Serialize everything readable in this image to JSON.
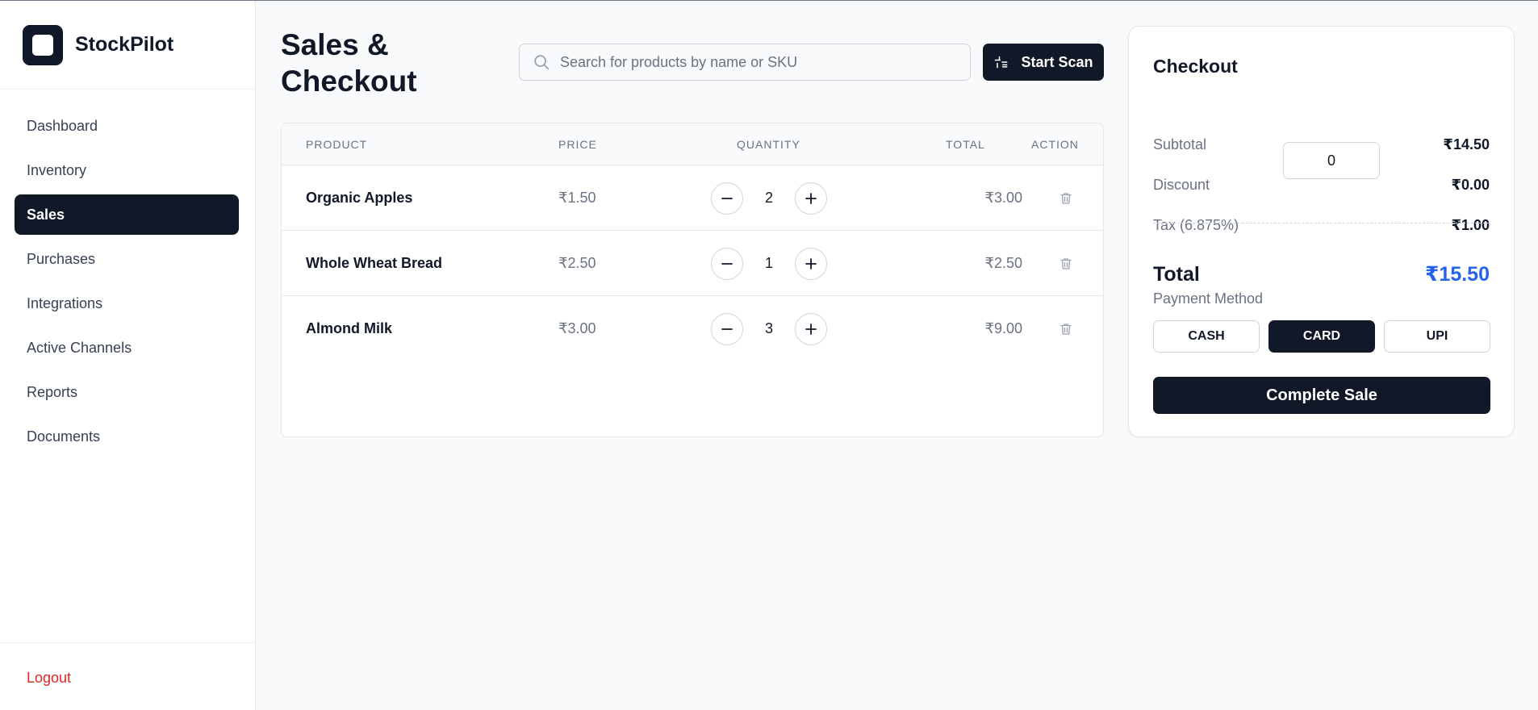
{
  "brand": {
    "name": "StockPilot",
    "icon": "app-logo-icon"
  },
  "sidebar": {
    "items": [
      {
        "label": "Dashboard",
        "active": false
      },
      {
        "label": "Inventory",
        "active": false
      },
      {
        "label": "Sales",
        "active": true
      },
      {
        "label": "Purchases",
        "active": false
      },
      {
        "label": "Integrations",
        "active": false
      },
      {
        "label": "Active Channels",
        "active": false
      },
      {
        "label": "Reports",
        "active": false
      },
      {
        "label": "Documents",
        "active": false
      }
    ],
    "logout_label": "Logout"
  },
  "header": {
    "title": "Sales & Checkout",
    "search_placeholder": "Search for products by name or SKU",
    "scan_label": "Start Scan"
  },
  "table": {
    "columns": [
      "PRODUCT",
      "PRICE",
      "QUANTITY",
      "TOTAL",
      "ACTION"
    ],
    "rows": [
      {
        "product": "Organic Apples",
        "price": "₹1.50",
        "quantity": "2",
        "total": "₹3.00"
      },
      {
        "product": "Whole Wheat Bread",
        "price": "₹2.50",
        "quantity": "1",
        "total": "₹2.50"
      },
      {
        "product": "Almond Milk",
        "price": "₹3.00",
        "quantity": "3",
        "total": "₹9.00"
      }
    ]
  },
  "checkout": {
    "title": "Checkout",
    "subtotal_label": "Subtotal",
    "subtotal_value": "₹14.50",
    "discount_label": "Discount",
    "discount_input": "0",
    "discount_value": "₹0.00",
    "tax_label": "Tax (6.875%)",
    "tax_value": "₹1.00",
    "total_label": "Total",
    "total_value": "₹15.50",
    "payment_label": "Payment Method",
    "payment_methods": [
      {
        "label": "CASH",
        "active": false
      },
      {
        "label": "CARD",
        "active": true
      },
      {
        "label": "UPI",
        "active": false
      }
    ],
    "complete_label": "Complete Sale"
  },
  "colors": {
    "primary": "#111827",
    "accent_total": "#2563eb",
    "logout": "#dc2626",
    "background": "#f8fafc"
  }
}
